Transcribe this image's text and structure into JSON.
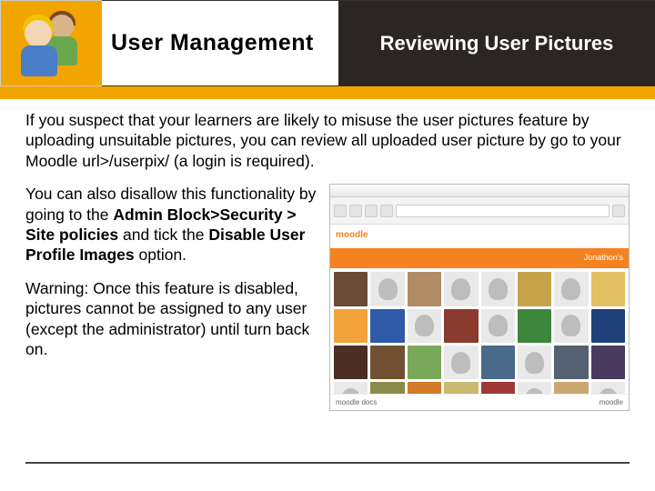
{
  "header": {
    "section_title": "User Management",
    "page_title": "Reviewing  User Pictures"
  },
  "body": {
    "para1": "If you suspect that your learners are likely to misuse the user pictures feature by uploading unsuitable pictures, you can review all uploaded user picture by go to your Moodle url>/userpix/ (a login is required).",
    "para2_a": "You can also disallow this functionality by going to the ",
    "para2_b": "Admin Block>Security > Site policies",
    "para2_c": " and tick the ",
    "para2_d": "Disable User Profile Images",
    "para2_e": " option.",
    "para3": "Warning: Once this feature is disabled, pictures cannot be assigned to any user (except the administrator) until turn back on."
  },
  "screenshot": {
    "logo_text": "moodle",
    "header_right": "Jonathon's",
    "footer_left": "moodle docs",
    "footer_right": "moodle",
    "avatar_colors": [
      "#6b4a36",
      "#e9e9e9",
      "#b08b63",
      "#e9e9e9",
      "#e9e9e9",
      "#c6a24a",
      "#e9e9e9",
      "#e0c060",
      "#f2a23a",
      "#2e5aa8",
      "#e9e9e9",
      "#8a3b2e",
      "#e9e9e9",
      "#3c863c",
      "#e9e9e9",
      "#20407a",
      "#4a2e24",
      "#705030",
      "#7aa85a",
      "#e9e9e9",
      "#4a6a8a",
      "#e9e9e9",
      "#556070",
      "#4a3a60",
      "#e9e9e9",
      "#8c8c4a",
      "#d47a2a",
      "#c8b870",
      "#a03838",
      "#e9e9e9",
      "#caa870",
      "#e9e9e9"
    ]
  }
}
